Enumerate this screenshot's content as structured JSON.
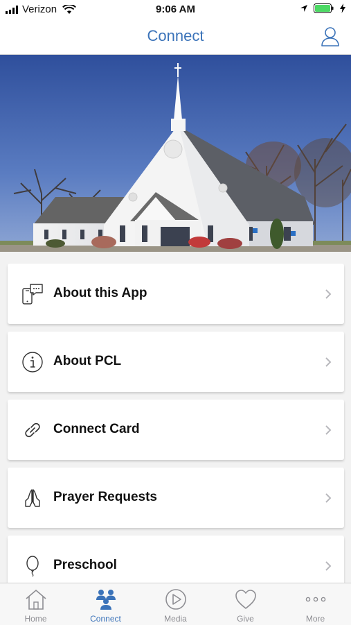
{
  "status_bar": {
    "carrier": "Verizon",
    "time": "9:06 AM"
  },
  "navbar": {
    "title": "Connect",
    "profile_icon": "user-icon"
  },
  "hero": {
    "image": "church building photo"
  },
  "menu": [
    {
      "label": "About this App",
      "icon": "phone-chat-icon"
    },
    {
      "label": "About PCL",
      "icon": "info-icon"
    },
    {
      "label": "Connect Card",
      "icon": "link-icon"
    },
    {
      "label": "Prayer Requests",
      "icon": "praying-hands-icon"
    },
    {
      "label": "Preschool",
      "icon": "balloon-icon"
    }
  ],
  "tabbar": {
    "tabs": [
      {
        "label": "Home",
        "icon": "home-icon",
        "active": false
      },
      {
        "label": "Connect",
        "icon": "people-icon",
        "active": true
      },
      {
        "label": "Media",
        "icon": "play-icon",
        "active": false
      },
      {
        "label": "Give",
        "icon": "heart-icon",
        "active": false
      },
      {
        "label": "More",
        "icon": "more-icon",
        "active": false
      }
    ]
  },
  "colors": {
    "accent": "#3b73b9",
    "inactive": "#8e8e93",
    "battery": "#4cd964"
  }
}
